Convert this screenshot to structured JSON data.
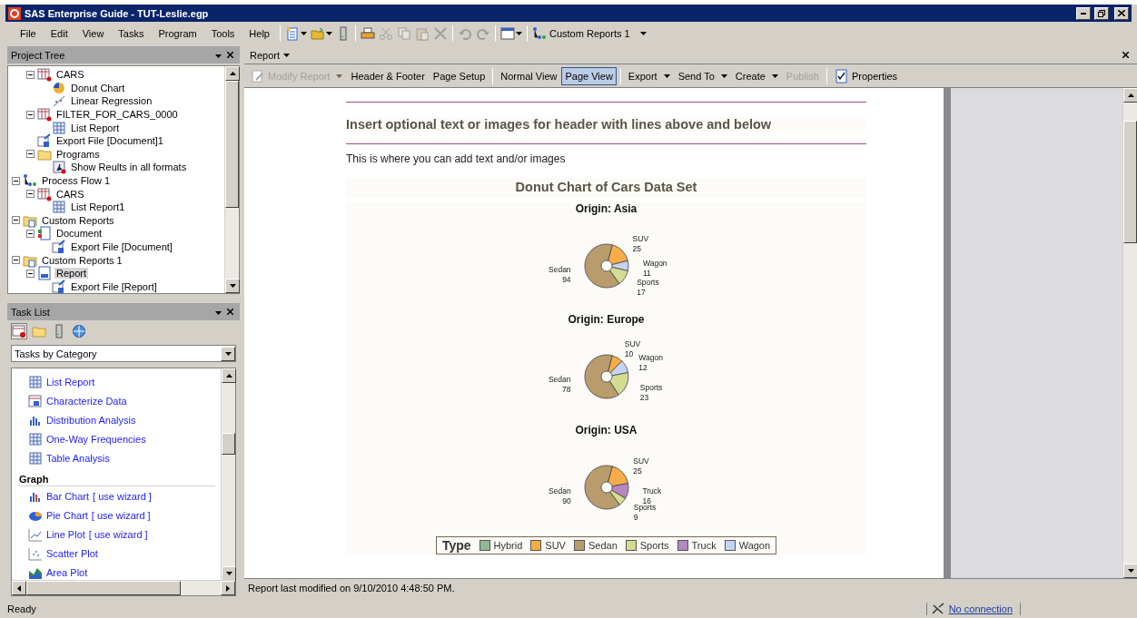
{
  "window": {
    "title": "SAS Enterprise Guide - TUT-Leslie.egp"
  },
  "menu": [
    "File",
    "Edit",
    "View",
    "Tasks",
    "Program",
    "Tools",
    "Help"
  ],
  "toolbar": [
    {
      "kind": "new",
      "dropdown": true,
      "disabled": false
    },
    {
      "kind": "open",
      "dropdown": true,
      "disabled": false
    },
    {
      "kind": "server",
      "dropdown": false,
      "disabled": false
    },
    {
      "kind": "print",
      "dropdown": false,
      "disabled": false
    },
    {
      "kind": "cut",
      "dropdown": false,
      "disabled": true
    },
    {
      "kind": "copy",
      "dropdown": false,
      "disabled": true
    },
    {
      "kind": "paste",
      "dropdown": false,
      "disabled": true
    },
    {
      "kind": "delete",
      "dropdown": false,
      "disabled": true
    },
    {
      "kind": "undo",
      "dropdown": false,
      "disabled": true
    },
    {
      "kind": "redo",
      "dropdown": false,
      "disabled": true
    },
    {
      "kind": "window",
      "dropdown": true,
      "disabled": false
    }
  ],
  "flow_selector": {
    "label": "Custom Reports 1"
  },
  "project_tree": {
    "title": "Project Tree",
    "items": [
      {
        "children": [
          {
            "label": "CARS",
            "kind": "data",
            "expanded": true,
            "selected": false,
            "children": [
              {
                "label": "Donut Chart",
                "kind": "donut",
                "selected": false
              },
              {
                "label": "Linear Regression",
                "kind": "regression",
                "selected": false
              }
            ]
          },
          {
            "label": "FILTER_FOR_CARS_0000",
            "kind": "data",
            "expanded": true,
            "selected": false,
            "children": [
              {
                "label": "List Report",
                "kind": "list",
                "selected": false
              }
            ]
          },
          {
            "label": "Export File [Document]1",
            "kind": "export",
            "selected": false
          },
          {
            "label": "Programs",
            "kind": "folder",
            "expanded": true,
            "selected": false,
            "children": [
              {
                "label": "Show Reults in all formats",
                "kind": "program",
                "selected": false
              }
            ]
          }
        ]
      },
      {
        "label": "Process Flow 1",
        "kind": "flow",
        "expanded": true,
        "selected": false,
        "children": [
          {
            "label": "CARS",
            "kind": "data",
            "expanded": true,
            "selected": false,
            "children": [
              {
                "label": "List Report1",
                "kind": "list",
                "selected": false
              }
            ]
          }
        ]
      },
      {
        "label": "Custom Reports",
        "kind": "reports",
        "expanded": true,
        "selected": false,
        "children": [
          {
            "label": "Document",
            "kind": "document",
            "expanded": true,
            "selected": false,
            "children": [
              {
                "label": "Export File [Document]",
                "kind": "export",
                "selected": false
              }
            ]
          }
        ]
      },
      {
        "label": "Custom Reports 1",
        "kind": "reports",
        "expanded": true,
        "selected": false,
        "children": [
          {
            "label": "Report",
            "kind": "report",
            "expanded": true,
            "selected": true,
            "children": [
              {
                "label": "Export File [Report]",
                "kind": "export",
                "selected": false
              }
            ]
          }
        ]
      }
    ]
  },
  "task_list": {
    "title": "Task List",
    "views": [
      {
        "kind": "category",
        "selected": true
      },
      {
        "kind": "folder",
        "selected": false
      },
      {
        "kind": "server",
        "selected": false
      },
      {
        "kind": "globe",
        "selected": false
      }
    ],
    "filter": "Tasks by Category",
    "items": [
      {
        "kind": "list",
        "label": "List Report"
      },
      {
        "kind": "characterize",
        "label": "Characterize Data"
      },
      {
        "kind": "distribution",
        "label": "Distribution Analysis"
      },
      {
        "kind": "frequencies",
        "label": "One-Way Frequencies"
      },
      {
        "kind": "table",
        "label": "Table Analysis"
      },
      {
        "kind": "group",
        "label": "Graph"
      },
      {
        "kind": "bar",
        "label": "Bar Chart",
        "wizard": "[ use wizard ]"
      },
      {
        "kind": "pie",
        "label": "Pie Chart",
        "wizard": "[ use wizard ]"
      },
      {
        "kind": "line",
        "label": "Line Plot",
        "wizard": "[ use wizard ]"
      },
      {
        "kind": "scatter",
        "label": "Scatter Plot"
      },
      {
        "kind": "area",
        "label": "Area Plot"
      }
    ]
  },
  "report": {
    "tab": "Report",
    "toolbar": [
      {
        "kind": "button",
        "label": "Modify Report",
        "disabled": true,
        "dropdown": true,
        "icon": true,
        "selected": false
      },
      {
        "kind": "button",
        "label": "Header & Footer",
        "disabled": false,
        "dropdown": false,
        "selected": false
      },
      {
        "kind": "button",
        "label": "Page Setup",
        "disabled": false,
        "dropdown": false,
        "selected": false
      },
      {
        "kind": "separator"
      },
      {
        "kind": "button",
        "label": "Normal View",
        "disabled": false,
        "dropdown": false,
        "selected": false
      },
      {
        "kind": "button",
        "label": "Page View",
        "disabled": false,
        "dropdown": false,
        "selected": true
      },
      {
        "kind": "separator"
      },
      {
        "kind": "button",
        "label": "Export",
        "disabled": false,
        "dropdown": true,
        "selected": false
      },
      {
        "kind": "button",
        "label": "Send To",
        "disabled": false,
        "dropdown": true,
        "selected": false
      },
      {
        "kind": "button",
        "label": "Create",
        "disabled": false,
        "dropdown": true,
        "selected": false
      },
      {
        "kind": "button",
        "label": "Publish",
        "disabled": true,
        "dropdown": false,
        "selected": false
      },
      {
        "kind": "separator"
      },
      {
        "kind": "button",
        "label": "Properties",
        "disabled": false,
        "dropdown": false,
        "icon": true,
        "selected": false
      }
    ],
    "header": "Insert optional text or images for header with lines above and below",
    "intro": "This is where you can add text and/or images",
    "title": "Donut Chart of Cars Data Set",
    "charts": [
      {
        "chart_data": {
          "type": "donut",
          "title": "Origin: Asia",
          "categories": [
            "SUV",
            "Wagon",
            "Sports",
            "Sedan"
          ],
          "colors": [
            "#f8ac48",
            "#c4d4f4",
            "#d4dc94",
            "#b89c6c"
          ],
          "series": [
            {
              "values": [
                25,
                11,
                17,
                94
              ]
            }
          ],
          "data_labels": true
        }
      },
      {
        "chart_data": {
          "type": "donut",
          "title": "Origin: Europe",
          "categories": [
            "SUV",
            "Wagon",
            "Sports",
            "Sedan"
          ],
          "colors": [
            "#f8ac48",
            "#c4d4f4",
            "#d4dc94",
            "#b89c6c"
          ],
          "series": [
            {
              "values": [
                10,
                12,
                23,
                78
              ]
            }
          ],
          "data_labels": true
        }
      },
      {
        "chart_data": {
          "type": "donut",
          "title": "Origin: USA",
          "categories": [
            "SUV",
            "Truck",
            "Sports",
            "Sedan"
          ],
          "colors": [
            "#f8ac48",
            "#b488c0",
            "#d4dc94",
            "#b89c6c"
          ],
          "series": [
            {
              "values": [
                25,
                16,
                9,
                90
              ]
            }
          ],
          "data_labels": true
        }
      }
    ],
    "legend": {
      "title": "Type",
      "items": [
        {
          "label": "Hybrid",
          "color": "#8cb894"
        },
        {
          "label": "SUV",
          "color": "#f8ac48"
        },
        {
          "label": "Sedan",
          "color": "#b89c6c"
        },
        {
          "label": "Sports",
          "color": "#d4dc94"
        },
        {
          "label": "Truck",
          "color": "#b488c0"
        },
        {
          "label": "Wagon",
          "color": "#c4d4f4"
        }
      ]
    },
    "status": "Report last modified on 9/10/2010 4:48:50 PM."
  },
  "status_bar": {
    "text": "Ready",
    "connection": "No connection"
  }
}
